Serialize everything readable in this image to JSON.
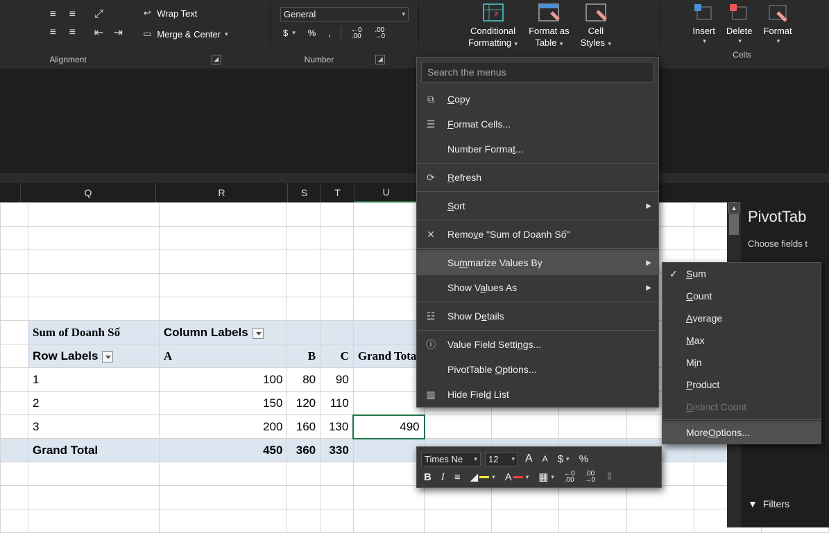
{
  "ribbon": {
    "wrap_text": "Wrap Text",
    "merge_center": "Merge & Center",
    "group_alignment": "Alignment",
    "number_format_box": "General",
    "currency": "$",
    "percent": "%",
    "comma": ",",
    "inc_dec": "←0\n.00",
    "dec_inc": ".00\n→0",
    "group_number": "Number",
    "conditional": "Conditional",
    "conditional2": "Formatting",
    "format_as": "Format as",
    "format_as2": "Table",
    "cell_styles": "Cell",
    "cell_styles2": "Styles",
    "insert": "Insert",
    "delete": "Delete",
    "format": "Format",
    "group_cells": "Cells"
  },
  "colHeaders": [
    "Q",
    "R",
    "S",
    "T",
    "U"
  ],
  "pivot": {
    "measure": "Sum of Doanh Số",
    "col_labels": "Column Labels",
    "row_labels": "Row Labels",
    "cols": [
      "A",
      "B",
      "C",
      "Grand Total"
    ],
    "rows": [
      {
        "label": "1",
        "v": [
          "100",
          "80",
          "90",
          ""
        ]
      },
      {
        "label": "2",
        "v": [
          "150",
          "120",
          "110",
          ""
        ]
      },
      {
        "label": "3",
        "v": [
          "200",
          "160",
          "130",
          "490"
        ]
      }
    ],
    "grand": {
      "label": "Grand Total",
      "v": [
        "450",
        "360",
        "330",
        ""
      ]
    }
  },
  "ctx": {
    "search": "Search the menus",
    "copy": "Copy",
    "format_cells": "Format Cells...",
    "number_format": "Number Format...",
    "refresh": "Refresh",
    "sort": "Sort",
    "remove": "Remove \"Sum of Doanh Số\"",
    "summarize": "Summarize Values By",
    "show_values": "Show Values As",
    "show_details": "Show Details",
    "vfs": "Value Field Settings...",
    "pto": "PivotTable Options...",
    "hide_field": "Hide Field List"
  },
  "sub": {
    "sum": "Sum",
    "count": "Count",
    "average": "Average",
    "max": "Max",
    "min": "Min",
    "product": "Product",
    "distinct": "Distinct Count",
    "more": "More Options..."
  },
  "mini": {
    "font": "Times Ne",
    "size": "12"
  },
  "side": {
    "title": "PivotTab",
    "choose": "Choose fields t",
    "filters": "Filters"
  }
}
